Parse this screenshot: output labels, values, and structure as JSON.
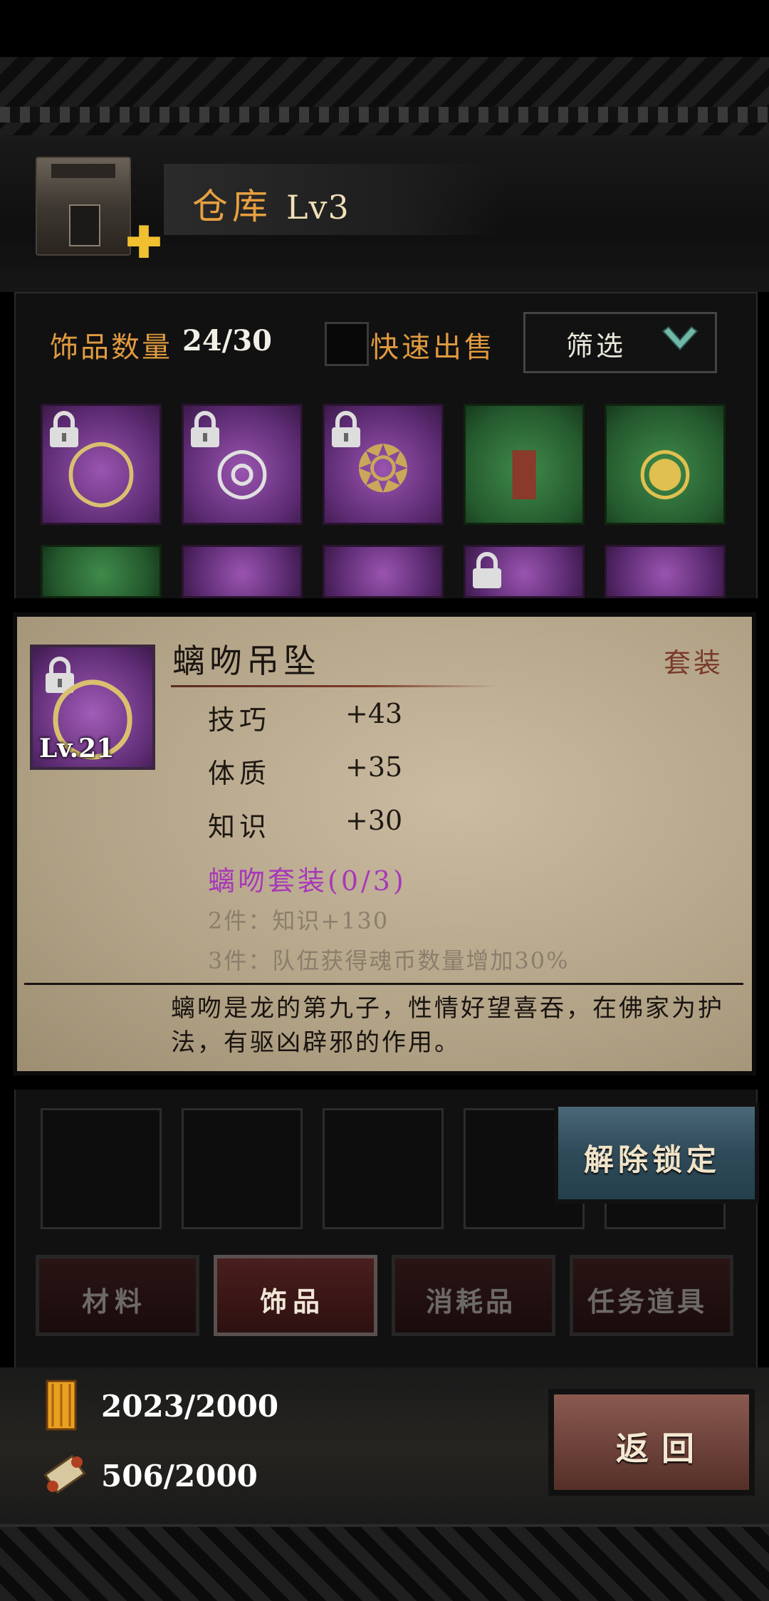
{
  "header": {
    "title": "仓库",
    "level": "Lv3"
  },
  "toolbar": {
    "count_label": "饰品数量",
    "count_value": "24/30",
    "quick_sell_label": "快速出售",
    "filter_label": "筛选"
  },
  "item_detail": {
    "name": "螭吻吊坠",
    "tag": "套装",
    "level": "Lv.21",
    "stats": [
      {
        "name": "技巧",
        "value": "+43"
      },
      {
        "name": "体质",
        "value": "+35"
      },
      {
        "name": "知识",
        "value": "+30"
      }
    ],
    "set_title": "螭吻套装(0/3)",
    "set_bonuses": [
      "2件：知识+130",
      "3件：队伍获得魂币数量增加30%"
    ],
    "description": "螭吻是龙的第九子，性情好望喜吞，在佛家为护法，有驱凶辟邪的作用。"
  },
  "actions": {
    "unlock_label": "解除锁定",
    "back_label": "返回"
  },
  "tabs": [
    "材料",
    "饰品",
    "消耗品",
    "任务道具"
  ],
  "currency": [
    "2023/2000",
    "506/2000"
  ],
  "colors": {
    "accent": "#e09a40",
    "purple_rarity": "#7a3d90",
    "green_rarity": "#2f6e3a",
    "set_text": "#a838b8"
  }
}
